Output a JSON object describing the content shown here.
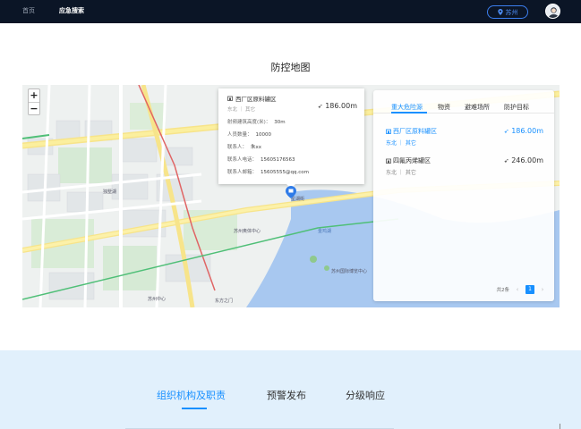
{
  "nav": {
    "items": [
      {
        "label": "首页"
      },
      {
        "label": "应急搜索"
      }
    ],
    "city": "苏州"
  },
  "page_title": "防控地图",
  "map": {
    "zoom_in": "+",
    "zoom_out": "−",
    "labels": {
      "l1": "独墅湖",
      "l2": "苏州奥体中心",
      "l3": "东方之门",
      "l4": "苏州中心",
      "l5": "金鸡湖",
      "l6": "苏州国际博览中心",
      "l7": "星湖街"
    }
  },
  "popup": {
    "name": "西厂区原料罐区",
    "distance": "186.00m",
    "sub": "东北 ｜ 其它",
    "rows": [
      {
        "key": "射频建筑高度(米)：",
        "val": "30m"
      },
      {
        "key": "人员数量：",
        "val": "10000"
      },
      {
        "key": "联系人：",
        "val": "朱xx"
      },
      {
        "key": "联系人电话：",
        "val": "15605176563"
      },
      {
        "key": "联系人邮箱：",
        "val": "15605555@qq.com"
      }
    ]
  },
  "panel": {
    "tabs": [
      "重大危险源",
      "物资",
      "避难场所",
      "防护目标"
    ],
    "items": [
      {
        "name": "西厂区原料罐区",
        "sub": "东北 ｜ 其它",
        "distance": "186.00m"
      },
      {
        "name": "四氟丙烯罐区",
        "sub": "东北 ｜ 其它",
        "distance": "246.00m"
      }
    ],
    "pager": {
      "total": "共2条",
      "prev": "‹",
      "page": "1",
      "next": "›"
    }
  },
  "bottom_tabs": [
    "组织机构及职责",
    "预警发布",
    "分级响应"
  ],
  "colors": {
    "accent": "#1890ff",
    "nav_bg": "#0b1526",
    "bottom_bg": "#e1f0fc",
    "water": "#a8c8f0"
  }
}
